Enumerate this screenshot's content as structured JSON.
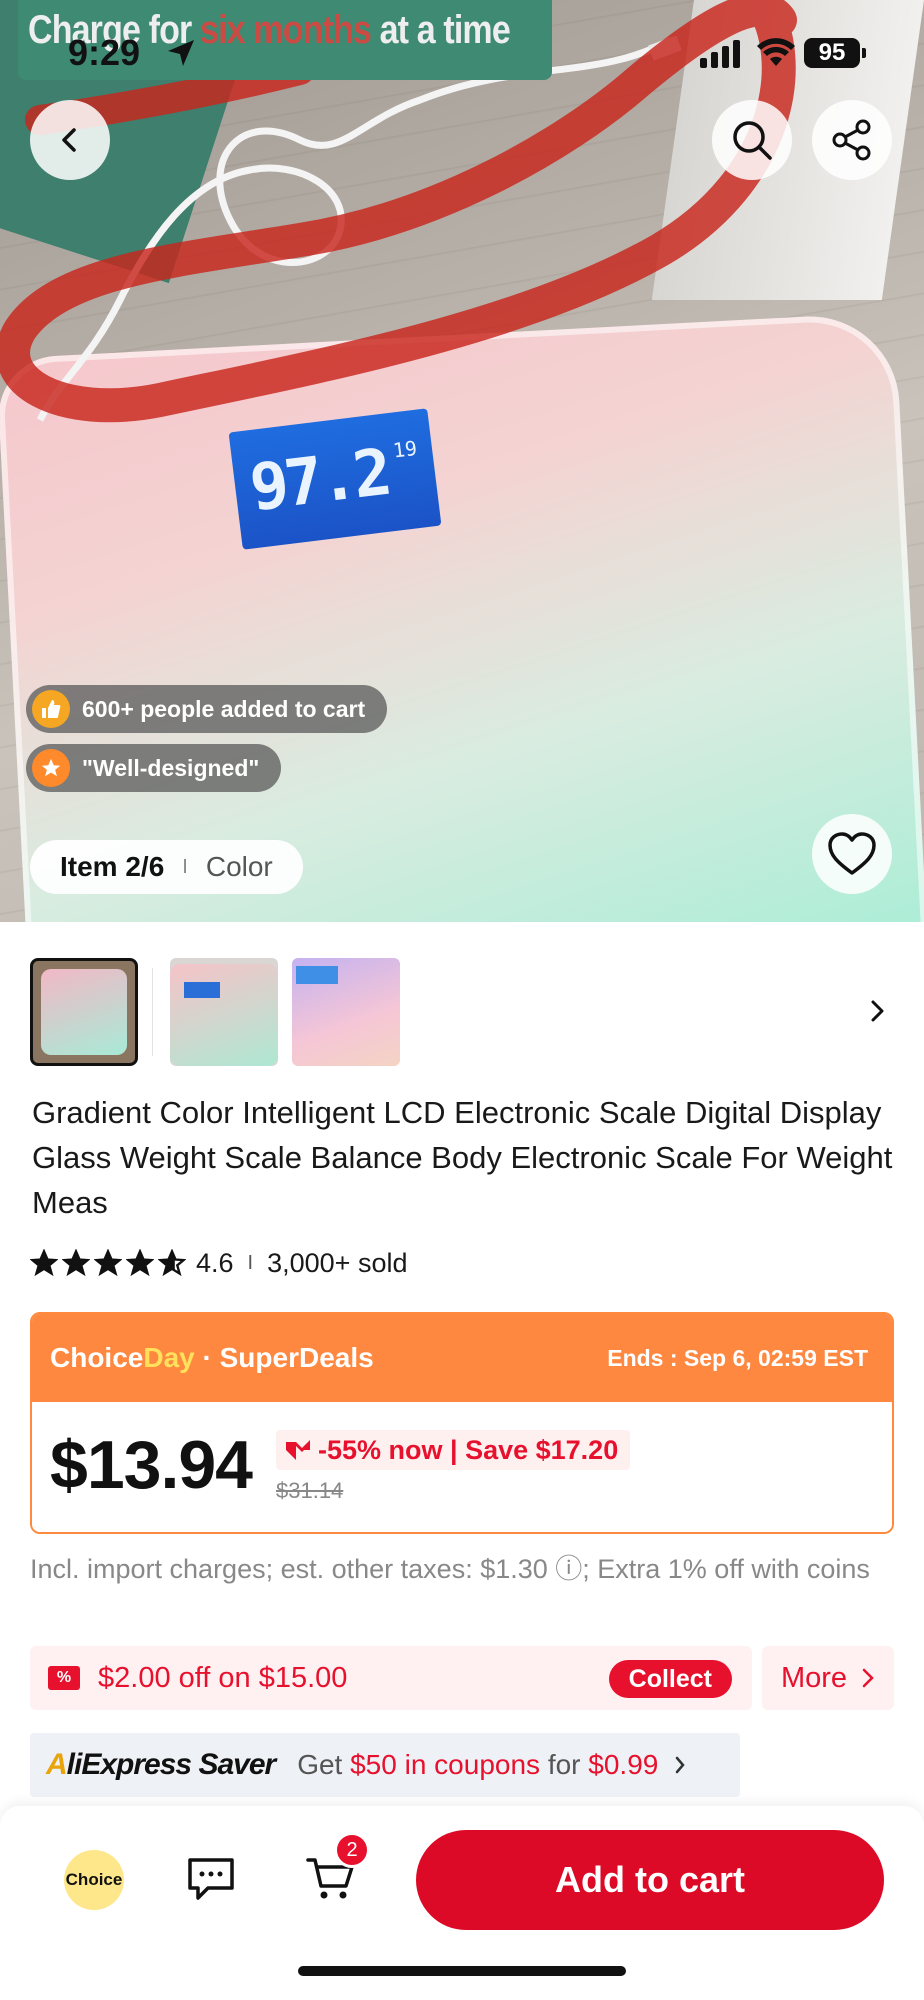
{
  "promo_banner": {
    "text_pre": "Charge for ",
    "text_hl": "six months",
    "text_post": " at a time"
  },
  "status_bar": {
    "time": "9:29",
    "battery": "95"
  },
  "scale_display": {
    "reading": "97.2",
    "small": "19"
  },
  "social_proof": [
    {
      "text": "600+ people added to cart",
      "icon": "thumbs-up-icon"
    },
    {
      "text": "\"Well-designed\"",
      "icon": "star-icon"
    }
  ],
  "item_pill": {
    "item": "Item 2/6",
    "sep": "I",
    "label": "Color"
  },
  "product": {
    "title": "Gradient Color Intelligent LCD Electronic Scale Digital Display Glass Weight Scale Balance Body Electronic Scale For Weight Meas",
    "rating": "4.6",
    "rating_value": 4.6,
    "sold": "3,000+ sold",
    "rating_sep": "I"
  },
  "deal": {
    "brand_a": "Choice",
    "brand_b": "Day",
    "brand_c": " · SuperDeals",
    "ends": "Ends : Sep 6, 02:59 EST",
    "price": "$13.94",
    "discount": "-55% now | Save $17.20",
    "old_price": "$31.14"
  },
  "tax_note": "Incl. import charges; est. other taxes: $1.30 ⓘ; Extra 1% off with coins",
  "coupon": {
    "icon": "%",
    "text": "$2.00 off on $15.00",
    "collect": "Collect",
    "more": "More"
  },
  "saver": {
    "logo_a": "A",
    "logo_rest": "liExpress ",
    "logo_saver": "Saver",
    "get": "Get ",
    "amount": "$50 in coupons",
    "for": " for ",
    "price": "$0.99"
  },
  "bottom_bar": {
    "choice": "Choice",
    "cart_count": "2",
    "add_to_cart": "Add to cart"
  },
  "colors": {
    "accent_red": "#dc0a26",
    "deal_orange": "#ff8840",
    "choice_yellow": "#ffe15c"
  }
}
